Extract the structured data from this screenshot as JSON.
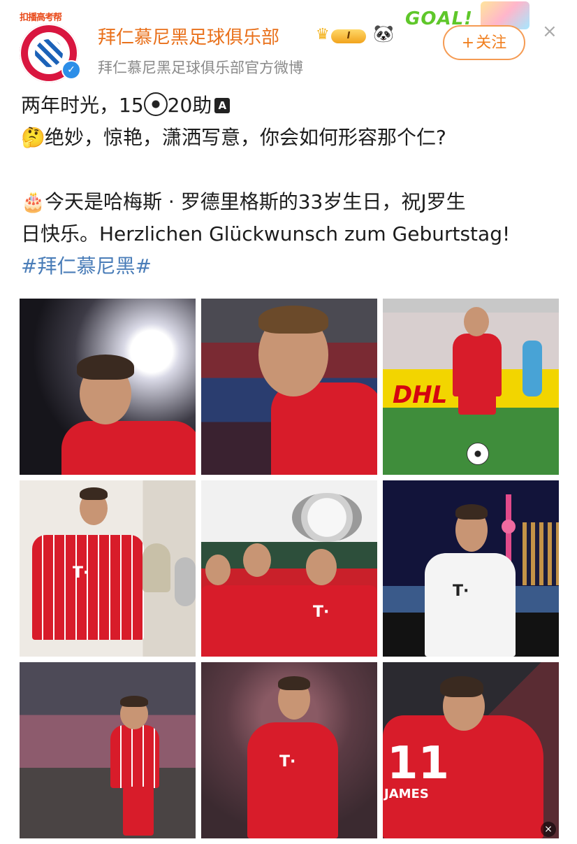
{
  "header": {
    "avatar_tag": "扣播高考帮",
    "avatar_ring_text": "FC BAYERN MÜNCHEN",
    "verified_icon": "verified-badge-icon",
    "name": "拜仁慕尼黑足球俱乐部",
    "level": "I",
    "subtitle": "拜仁慕尼黑足球俱乐部官方微博",
    "goal_text": "GOAL!",
    "follow_plus": "+",
    "follow_label": "关注",
    "close_symbol": "×"
  },
  "post": {
    "line1_a": "两年时光，15",
    "line1_b": "20助",
    "line1_badge": "A",
    "line2_emoji": "🤔",
    "line2": "绝妙，惊艳，潇洒写意，你会如何形容那个仁?",
    "line3_emoji": "🎂",
    "line3": "今天是哈梅斯 · 罗德里格斯的33岁生日，祝J罗生",
    "line4": "日快乐。Herzlichen Glückwunsch zum Geburtstag!",
    "hashtag": "#拜仁慕尼黑#"
  },
  "photos": {
    "count": 9,
    "p3_sponsor": "DHL",
    "p9_number": "11",
    "p9_name": "JAMES"
  },
  "colors": {
    "name": "#e9711c",
    "follow": "#f07f1f",
    "hashtag": "#4a7db8",
    "bayern_red": "#d81c2a"
  }
}
